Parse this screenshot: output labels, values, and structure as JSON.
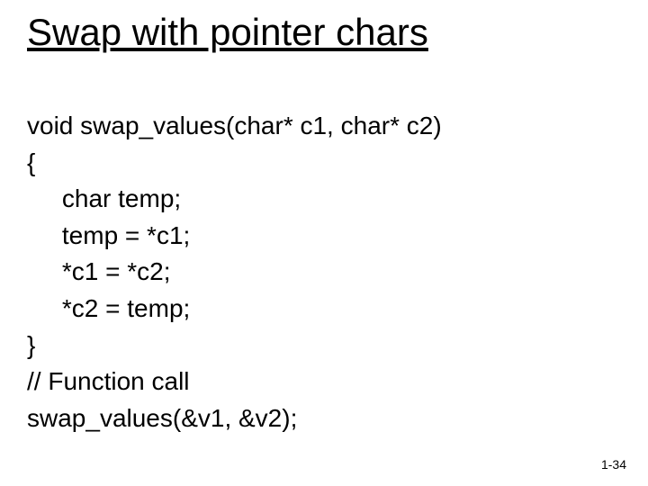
{
  "title": "Swap with pointer chars",
  "code": {
    "line1": "void swap_values(char* c1, char* c2)",
    "line2": "{",
    "line3": "     char temp;",
    "line4": "     temp = *c1;",
    "line5": "     *c1 = *c2;",
    "line6": "     *c2 = temp;",
    "line7": "}",
    "line8": "// Function call",
    "line9": "swap_values(&v1, &v2);"
  },
  "page_number": "1-34"
}
